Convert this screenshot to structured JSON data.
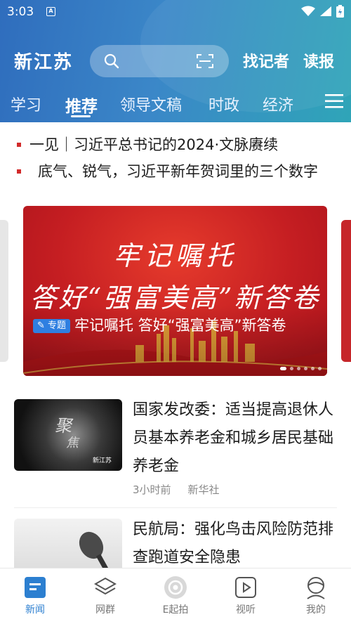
{
  "status_bar": {
    "time": "3:03",
    "notif_letter": "A"
  },
  "header": {
    "brand": "新江苏",
    "reporter_label": "找记者",
    "read_label": "读报"
  },
  "tabs": [
    {
      "label": "学习"
    },
    {
      "label": "推荐"
    },
    {
      "label": "领导文稿"
    },
    {
      "label": "时政"
    },
    {
      "label": "经济"
    }
  ],
  "headlines": [
    {
      "text": "一见｜习近平总书记的2024·文脉赓续"
    },
    {
      "text": "底气、锐气，习近平新年贺词里的三个数字"
    }
  ],
  "banner": {
    "calligraphy_line1": "牢记嘱托",
    "calligraphy_line2": "答好“强富美高”新答卷",
    "badge": "专题",
    "caption": "牢记嘱托 答好“强富美高”新答卷"
  },
  "news": [
    {
      "title": "国家发改委：适当提高退休人员基本养老金和城乡居民基础养老金",
      "time": "3小时前",
      "source": "新华社",
      "thumb_text1": "聚",
      "thumb_text2": "焦",
      "thumb_logo": "新江苏"
    },
    {
      "title": "民航局：强化鸟击风险防范排查跑道安全隐患"
    }
  ],
  "bottom_nav": [
    {
      "label": "新闻",
      "icon": "news-icon",
      "active": true
    },
    {
      "label": "网群",
      "icon": "layers-icon"
    },
    {
      "label": "E起拍",
      "icon": "camera-lens-icon"
    },
    {
      "label": "视听",
      "icon": "play-icon"
    },
    {
      "label": "我的",
      "icon": "profile-icon"
    }
  ],
  "colors": {
    "accent": "#2c7fd0",
    "banner_red": "#c51e22",
    "headline_dot": "#d22a2a"
  }
}
